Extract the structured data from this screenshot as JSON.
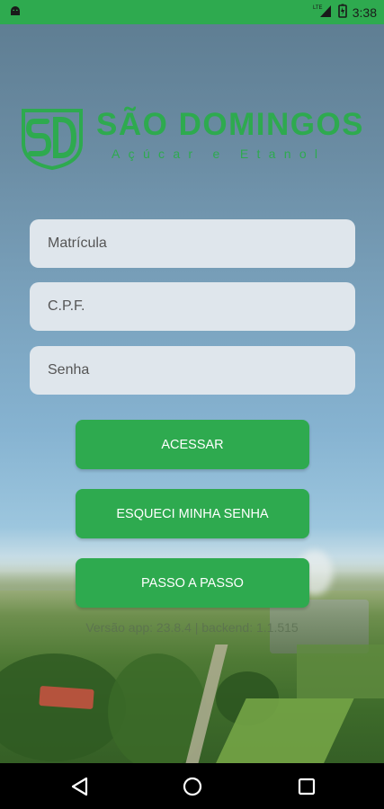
{
  "status_bar": {
    "time": "3:38",
    "network_label": "LTE",
    "icons": [
      "android-debug-icon",
      "signal-icon",
      "battery-icon"
    ]
  },
  "logo": {
    "title": "SÃO DOMINGOS",
    "subtitle": "Açúcar e Etanol",
    "color": "#2eaa4f"
  },
  "form": {
    "matricula_placeholder": "Matrícula",
    "cpf_placeholder": "C.P.F.",
    "senha_placeholder": "Senha"
  },
  "buttons": {
    "acessar": "ACESSAR",
    "esqueci_senha": "ESQUECI MINHA SENHA",
    "passo_a_passo": "PASSO A PASSO"
  },
  "version_text": "Versão app: 23.8.4 | backend: 1.1.515",
  "colors": {
    "accent": "#2eaa4f",
    "input_bg": "#dfe6ec"
  },
  "nav": {
    "icons": [
      "back-icon",
      "home-icon",
      "recents-icon"
    ]
  }
}
